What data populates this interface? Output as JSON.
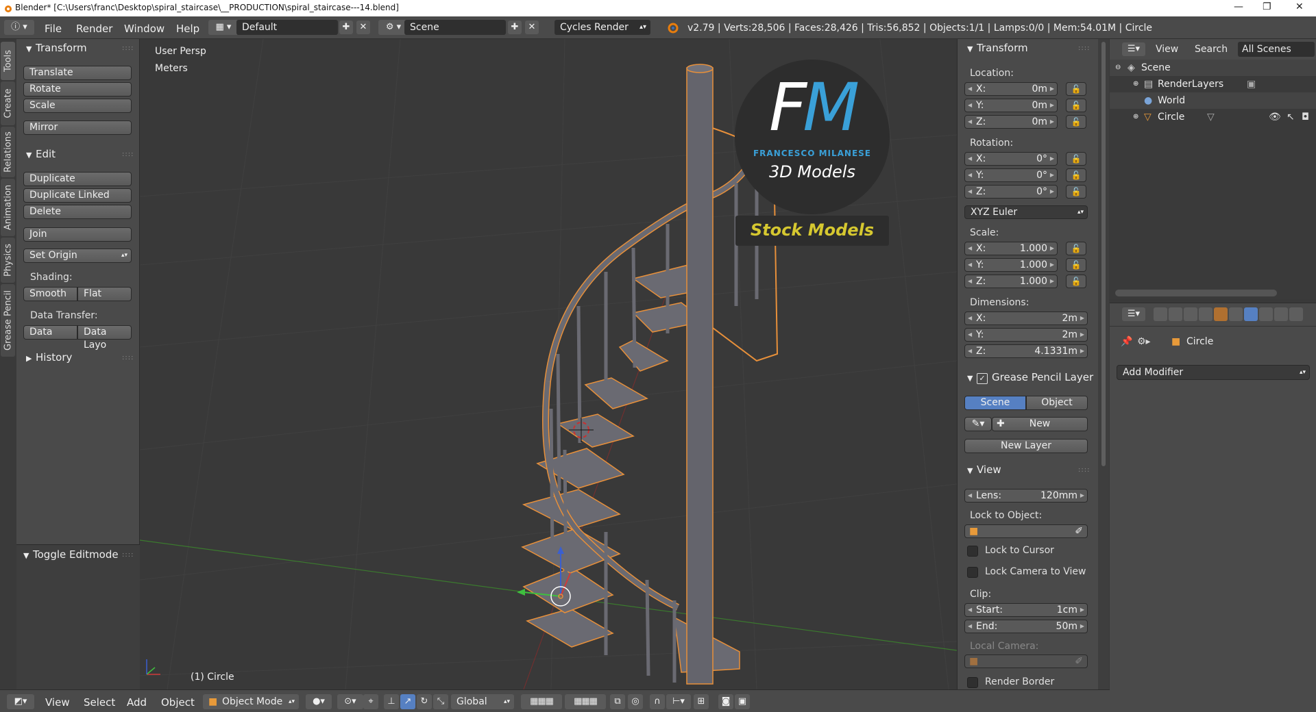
{
  "window": {
    "title": "Blender* [C:\\Users\\franc\\Desktop\\spiral_staircase\\__PRODUCTION\\spiral_staircase---14.blend]"
  },
  "info_header": {
    "menus": [
      "File",
      "Render",
      "Window",
      "Help"
    ],
    "screen_layout": "Default",
    "scene": "Scene",
    "render_engine": "Cycles Render",
    "stats": "v2.79 | Verts:28,506 | Faces:28,426 | Tris:56,852 | Objects:1/1 | Lamps:0/0 | Mem:54.01M | Circle"
  },
  "left_tabs": [
    "Tools",
    "Create",
    "Relations",
    "Animation",
    "Physics",
    "Grease Pencil"
  ],
  "tool_shelf": {
    "transform": {
      "title": "Transform",
      "buttons": [
        "Translate",
        "Rotate",
        "Scale",
        "Mirror"
      ]
    },
    "edit": {
      "title": "Edit",
      "buttons": [
        "Duplicate",
        "Duplicate Linked",
        "Delete",
        "Join"
      ],
      "set_origin": "Set Origin",
      "shading_label": "Shading:",
      "shading": [
        "Smooth",
        "Flat"
      ],
      "data_transfer_label": "Data Transfer:",
      "data_transfer": [
        "Data",
        "Data Layo"
      ]
    },
    "history": "History",
    "operator": "Toggle Editmode"
  },
  "viewport": {
    "view_name": "User Persp",
    "units": "Meters",
    "object_label": "(1) Circle",
    "watermark": {
      "brand": "FM",
      "line1": "FRANCESCO MILANESE",
      "line2": "3D Models",
      "banner": "Stock Models"
    }
  },
  "n_panel": {
    "transform_title": "Transform",
    "location_label": "Location:",
    "location": [
      {
        "k": "X:",
        "v": "0m"
      },
      {
        "k": "Y:",
        "v": "0m"
      },
      {
        "k": "Z:",
        "v": "0m"
      }
    ],
    "rotation_label": "Rotation:",
    "rotation": [
      {
        "k": "X:",
        "v": "0°"
      },
      {
        "k": "Y:",
        "v": "0°"
      },
      {
        "k": "Z:",
        "v": "0°"
      }
    ],
    "rotation_mode": "XYZ Euler",
    "scale_label": "Scale:",
    "scale": [
      {
        "k": "X:",
        "v": "1.000"
      },
      {
        "k": "Y:",
        "v": "1.000"
      },
      {
        "k": "Z:",
        "v": "1.000"
      }
    ],
    "dimensions_label": "Dimensions:",
    "dimensions": [
      {
        "k": "X:",
        "v": "2m"
      },
      {
        "k": "Y:",
        "v": "2m"
      },
      {
        "k": "Z:",
        "v": "4.1331m"
      }
    ],
    "grease_title": "Grease Pencil Layer",
    "grease_tabs": [
      "Scene",
      "Object"
    ],
    "grease_new": "New",
    "grease_new_layer": "New Layer",
    "view_title": "View",
    "lens_key": "Lens:",
    "lens_val": "120mm",
    "lock_to_object": "Lock to Object:",
    "lock_to_cursor": "Lock to Cursor",
    "lock_camera": "Lock Camera to View",
    "clip_label": "Clip:",
    "clip": [
      {
        "k": "Start:",
        "v": "1cm"
      },
      {
        "k": "End:",
        "v": "50m"
      }
    ],
    "local_camera": "Local Camera:",
    "render_border": "Render Border"
  },
  "outliner": {
    "header": [
      "View",
      "Search",
      "All Scenes"
    ],
    "items": [
      "Scene",
      "RenderLayers",
      "World",
      "Circle"
    ]
  },
  "properties": {
    "object_name": "Circle",
    "add_modifier": "Add Modifier"
  },
  "bottom_header": {
    "menus": [
      "View",
      "Select",
      "Add",
      "Object"
    ],
    "mode": "Object Mode",
    "orientation": "Global"
  },
  "colors": {
    "selection_outline": "#e8903a",
    "active_blue": "#5680c2",
    "watermark_blue": "#3aa0d8",
    "banner_text": "#d6c830"
  }
}
